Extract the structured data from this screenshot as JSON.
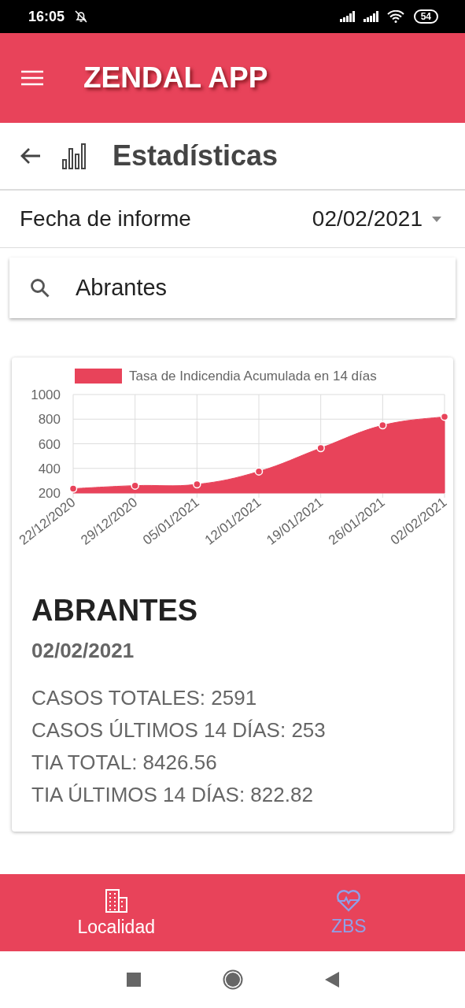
{
  "status_bar": {
    "time": "16:05",
    "battery": "54"
  },
  "app_bar": {
    "title": "ZENDAL APP"
  },
  "header": {
    "title": "Estadísticas"
  },
  "report_date": {
    "label": "Fecha de informe",
    "value": "02/02/2021"
  },
  "search": {
    "value": "Abrantes"
  },
  "card": {
    "chart_data": {
      "type": "area",
      "categories": [
        "22/12/2020",
        "29/12/2020",
        "05/01/2021",
        "12/01/2021",
        "19/01/2021",
        "26/01/2021",
        "02/02/2021"
      ],
      "series": [
        {
          "name": "Tasa de Indicendia Acumulada en 14 días",
          "color": "#e8435a",
          "values": [
            235,
            260,
            270,
            375,
            565,
            750,
            820
          ]
        }
      ],
      "grid": true,
      "ylim": [
        200,
        1000
      ],
      "yticks": [
        200,
        400,
        600,
        800,
        1000
      ]
    },
    "title": "ABRANTES",
    "date": "02/02/2021",
    "stats": [
      "CASOS TOTALES: 2591",
      "CASOS ÚLTIMOS 14 DÍAS: 253",
      "TIA TOTAL: 8426.56",
      "TIA ÚLTIMOS 14 DÍAS: 822.82"
    ]
  },
  "bottom_nav": [
    {
      "label": "Localidad",
      "kind": "building",
      "selected": false
    },
    {
      "label": "ZBS",
      "kind": "heart",
      "selected": true
    }
  ]
}
